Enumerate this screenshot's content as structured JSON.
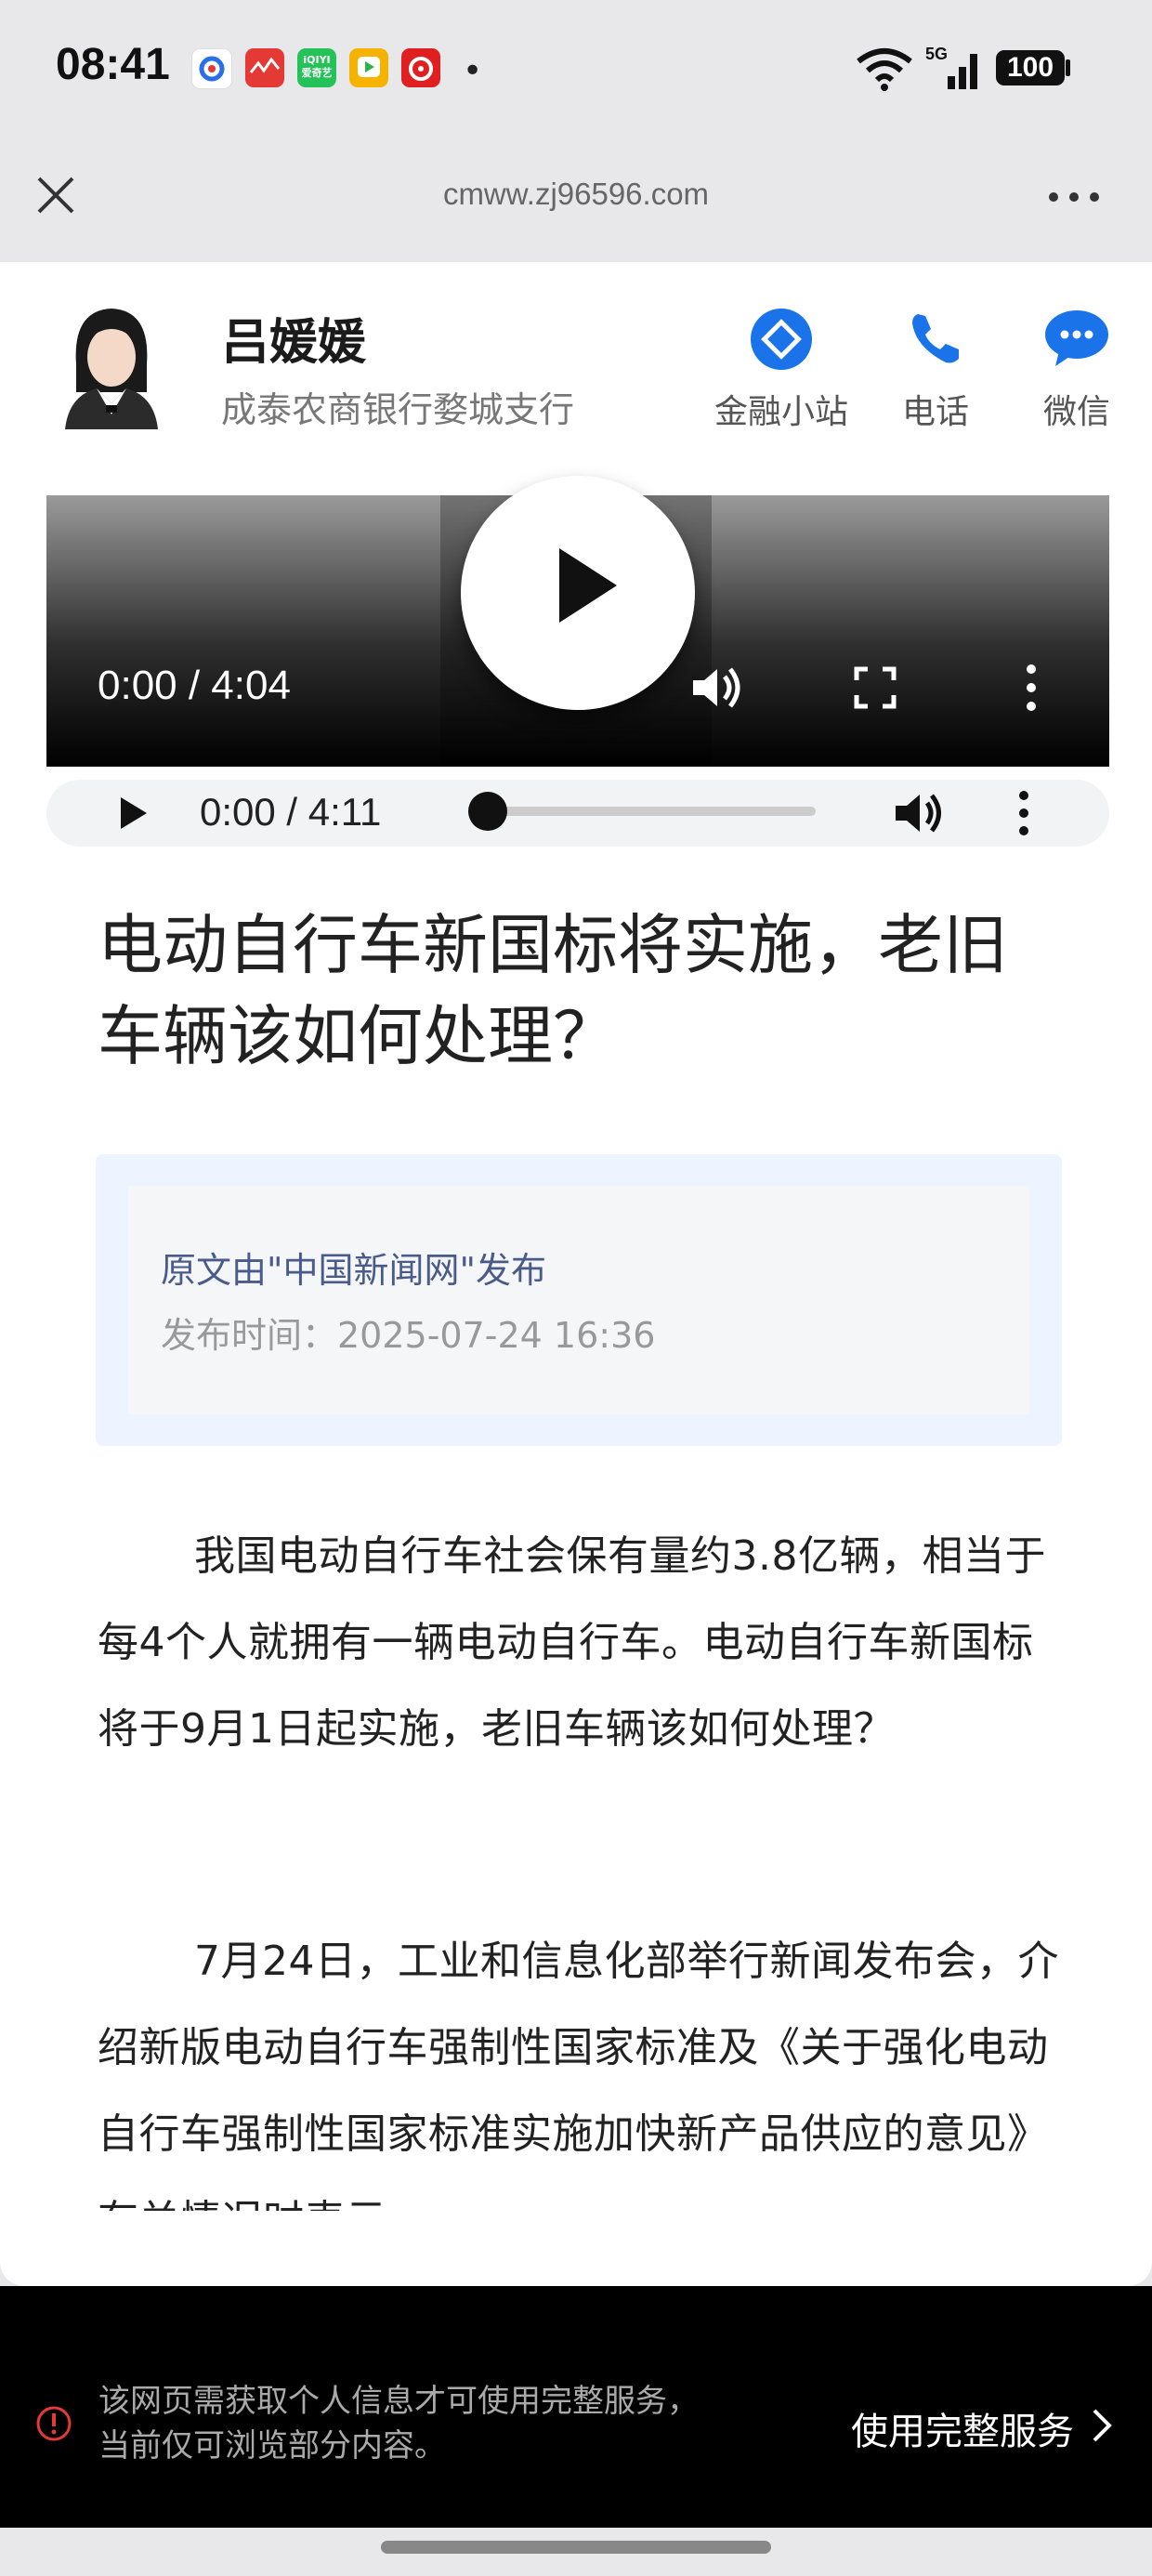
{
  "status_bar": {
    "time": "08:41",
    "network": "5G",
    "battery": "100",
    "app_icons": [
      "baidu-app-icon",
      "news-app-icon",
      "iqiyi-app-icon",
      "video-app-icon",
      "netease-music-app-icon"
    ]
  },
  "browser": {
    "url": "cmww.zj96596.com"
  },
  "profile": {
    "name": "吕媛媛",
    "branch": "成泰农商银行婺城支行",
    "actions": [
      {
        "label": "金融小站",
        "icon": "finance-station-icon"
      },
      {
        "label": "电话",
        "icon": "phone-icon"
      },
      {
        "label": "微信",
        "icon": "wechat-icon"
      }
    ],
    "accent_color": "#1a73e8"
  },
  "video": {
    "time": "0:00 / 4:04"
  },
  "audio": {
    "time": "0:00 / 4:11",
    "progress": 0
  },
  "article": {
    "title": "电动自行车新国标将实施，老旧车辆该如何处理？",
    "source": "原文由\"中国新闻网\"发布",
    "publish_time": "发布时间：2025-07-24 16:36",
    "paragraphs": [
      "我国电动自行车社会保有量约3.8亿辆，相当于每4个人就拥有一辆电动自行车。电动自行车新国标将于9月1日起实施，老旧车辆该如何处理？",
      "7月24日，工业和信息化部举行新闻发布会，介绍新版电动自行车强制性国家标准及《关于强化电动自行车强制性国家标准实施加快新产品供应的意见》有关情况时表示"
    ]
  },
  "notice": {
    "line1": "该网页需获取个人信息才可使用完整服务，",
    "line2": "当前仅可浏览部分内容。",
    "action": "使用完整服务"
  }
}
